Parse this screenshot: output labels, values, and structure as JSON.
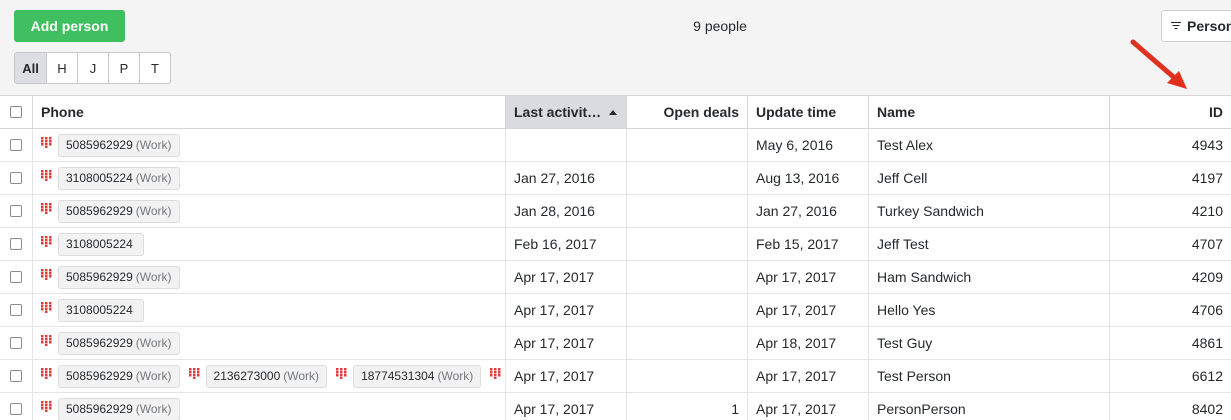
{
  "toolbar": {
    "add_label": "Add person",
    "count": "9 people",
    "filter_label": "Person"
  },
  "letters": [
    "All",
    "H",
    "J",
    "P",
    "T"
  ],
  "columns": {
    "phone": "Phone",
    "last_activity": "Last activit…",
    "open_deals": "Open deals",
    "update_time": "Update time",
    "name": "Name",
    "id": "ID"
  },
  "rows": [
    {
      "phones": [
        {
          "number": "5085962929",
          "label": "(Work)"
        }
      ],
      "last_activity": "",
      "open_deals": "",
      "update_time": "May 6, 2016",
      "name": "Test Alex",
      "id": "4943"
    },
    {
      "phones": [
        {
          "number": "3108005224",
          "label": "(Work)"
        }
      ],
      "last_activity": "Jan 27, 2016",
      "open_deals": "",
      "update_time": "Aug 13, 2016",
      "name": "Jeff Cell",
      "id": "4197"
    },
    {
      "phones": [
        {
          "number": "5085962929",
          "label": "(Work)"
        }
      ],
      "last_activity": "Jan 28, 2016",
      "open_deals": "",
      "update_time": "Jan 27, 2016",
      "name": "Turkey Sandwich",
      "id": "4210"
    },
    {
      "phones": [
        {
          "number": "3108005224",
          "label": ""
        }
      ],
      "last_activity": "Feb 16, 2017",
      "open_deals": "",
      "update_time": "Feb 15, 2017",
      "name": "Jeff Test",
      "id": "4707"
    },
    {
      "phones": [
        {
          "number": "5085962929",
          "label": "(Work)"
        }
      ],
      "last_activity": "Apr 17, 2017",
      "open_deals": "",
      "update_time": "Apr 17, 2017",
      "name": "Ham Sandwich",
      "id": "4209"
    },
    {
      "phones": [
        {
          "number": "3108005224",
          "label": ""
        }
      ],
      "last_activity": "Apr 17, 2017",
      "open_deals": "",
      "update_time": "Apr 17, 2017",
      "name": "Hello Yes",
      "id": "4706"
    },
    {
      "phones": [
        {
          "number": "5085962929",
          "label": "(Work)"
        }
      ],
      "last_activity": "Apr 17, 2017",
      "open_deals": "",
      "update_time": "Apr 18, 2017",
      "name": "Test Guy",
      "id": "4861"
    },
    {
      "phones": [
        {
          "number": "5085962929",
          "label": "(Work)"
        },
        {
          "number": "2136273000",
          "label": "(Work)"
        },
        {
          "number": "18774531304",
          "label": "(Work)"
        },
        {
          "number": "",
          "label": ""
        }
      ],
      "last_activity": "Apr 17, 2017",
      "open_deals": "",
      "update_time": "Apr 17, 2017",
      "name": "Test Person",
      "id": "6612"
    },
    {
      "phones": [
        {
          "number": "5085962929",
          "label": "(Work)"
        }
      ],
      "last_activity": "Apr 17, 2017",
      "open_deals": "1",
      "update_time": "Apr 17, 2017",
      "name": "PersonPerson",
      "id": "8402"
    }
  ],
  "colors": {
    "accent": "#3fbf5f",
    "sorted_header": "#d9dbe0",
    "phone_icon": "#e03a3a",
    "annotation_arrow": "#e0311f"
  }
}
